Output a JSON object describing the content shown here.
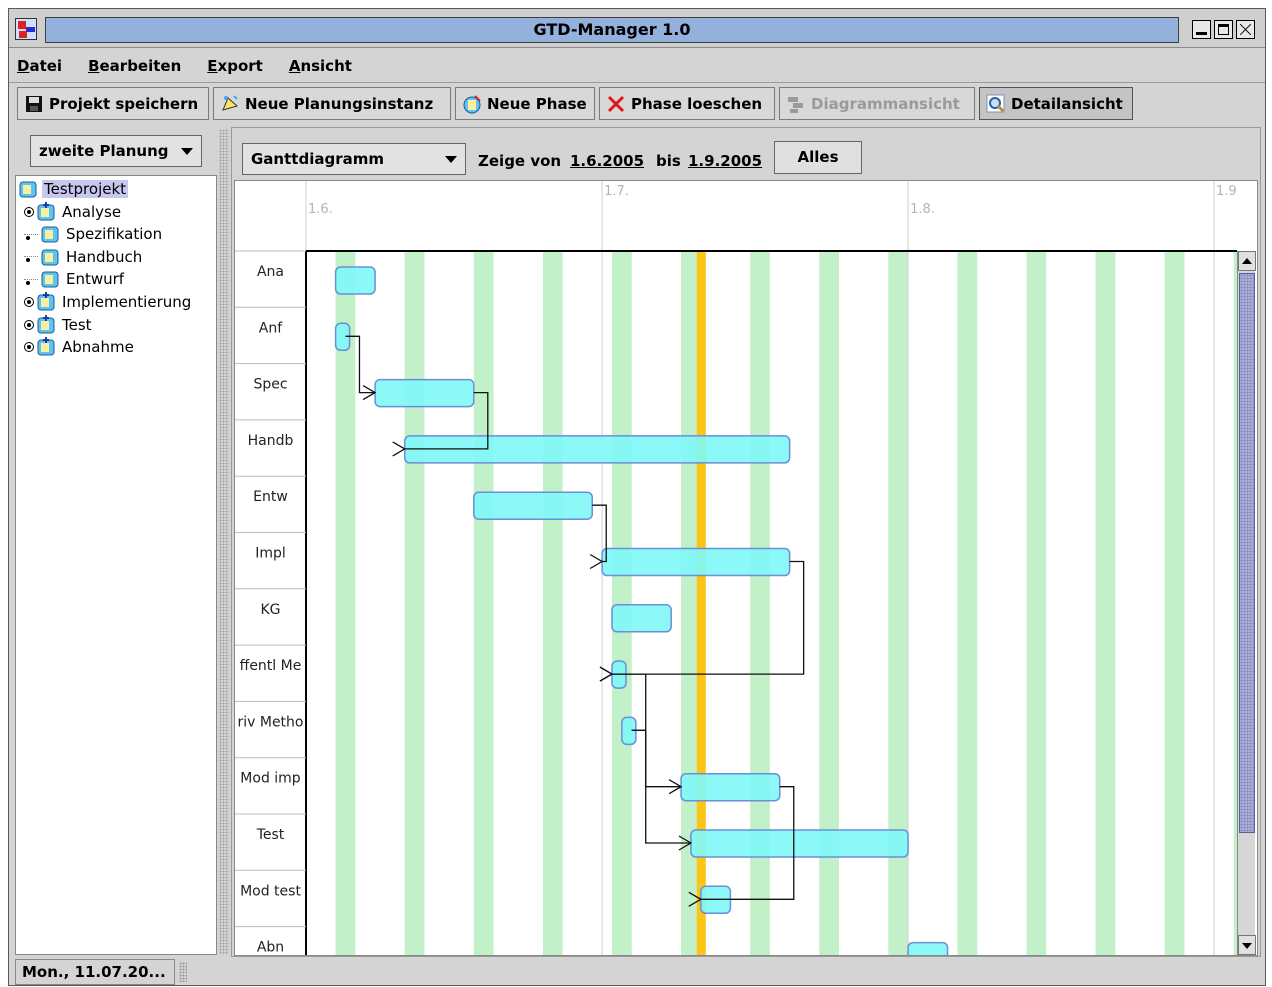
{
  "window": {
    "title": "GTD-Manager 1.0"
  },
  "menu": [
    "Datei",
    "Bearbeiten",
    "Export",
    "Ansicht"
  ],
  "toolbar": [
    {
      "label": "Projekt speichern",
      "icon": "save-icon",
      "state": "normal"
    },
    {
      "label": "Neue Planungsinstanz",
      "icon": "new-planning-icon",
      "state": "normal"
    },
    {
      "label": "Neue Phase",
      "icon": "new-phase-icon",
      "state": "normal"
    },
    {
      "label": "Phase loeschen",
      "icon": "delete-icon",
      "state": "normal"
    },
    {
      "label": "Diagrammansicht",
      "icon": "diagram-icon",
      "state": "disabled"
    },
    {
      "label": "Detailansicht",
      "icon": "magnifier-icon",
      "state": "pressed"
    }
  ],
  "planning_select": {
    "value": "zweite Planung"
  },
  "tree": [
    {
      "label": "Testprojekt",
      "level": 0,
      "selected": true,
      "expandable": false
    },
    {
      "label": "Analyse",
      "level": 1,
      "expandable": true
    },
    {
      "label": "Spezifikation",
      "level": 1,
      "expandable": false
    },
    {
      "label": "Handbuch",
      "level": 1,
      "expandable": false
    },
    {
      "label": "Entwurf",
      "level": 1,
      "expandable": false
    },
    {
      "label": "Implementierung",
      "level": 1,
      "expandable": true
    },
    {
      "label": "Test",
      "level": 1,
      "expandable": true
    },
    {
      "label": "Abnahme",
      "level": 1,
      "expandable": true
    }
  ],
  "view": {
    "type": "Ganttdiagramm",
    "show_from_label": "Zeige von",
    "from": "1.6.2005",
    "to_label": "bis",
    "to": "1.9.2005",
    "all_button": "Alles"
  },
  "gantt": {
    "month_labels": [
      "1.6.",
      "1.7.",
      "1.8.",
      "1.9"
    ],
    "current_day": "2005-07-11",
    "colors": {
      "bar": "#7ff7f7",
      "bar_border": "#6a8fd8",
      "weekend": "#c2f0c8",
      "today": "#fcc414"
    },
    "phases": [
      {
        "label": "Ana",
        "start": "2005-06-04",
        "end": "2005-06-08"
      },
      {
        "label": "Anf",
        "start": "2005-06-04",
        "end": "2005-06-05"
      },
      {
        "label": "Spec",
        "start": "2005-06-08",
        "end": "2005-06-18"
      },
      {
        "label": "Handb",
        "start": "2005-06-11",
        "end": "2005-07-20"
      },
      {
        "label": "Entw",
        "start": "2005-06-18",
        "end": "2005-06-30"
      },
      {
        "label": "Impl",
        "start": "2005-07-01",
        "end": "2005-07-20"
      },
      {
        "label": "KG",
        "start": "2005-07-02",
        "end": "2005-07-08"
      },
      {
        "label": "ffentl Me",
        "start": "2005-07-02",
        "end": "2005-07-03"
      },
      {
        "label": "riv Metho",
        "start": "2005-07-03",
        "end": "2005-07-04"
      },
      {
        "label": "Mod imp",
        "start": "2005-07-09",
        "end": "2005-07-19"
      },
      {
        "label": "Test",
        "start": "2005-07-10",
        "end": "2005-08-01"
      },
      {
        "label": "Mod test",
        "start": "2005-07-11",
        "end": "2005-07-14"
      },
      {
        "label": "Abn",
        "start": "2005-08-01",
        "end": "2005-08-05"
      }
    ],
    "dependencies": [
      {
        "from": "Anf",
        "to": "Spec"
      },
      {
        "from": "Spec",
        "to": "Handb"
      },
      {
        "from": "Entw",
        "to": "Impl"
      },
      {
        "from": "Impl",
        "to": "ffentl Me"
      },
      {
        "from": "riv Metho",
        "to": "ffentl Me"
      },
      {
        "from": "riv Metho",
        "to": "Mod imp"
      },
      {
        "from": "riv Metho",
        "to": "Test"
      },
      {
        "from": "Mod imp",
        "to": "Mod test"
      }
    ]
  },
  "status": {
    "date": "Mon., 11.07.20..."
  }
}
